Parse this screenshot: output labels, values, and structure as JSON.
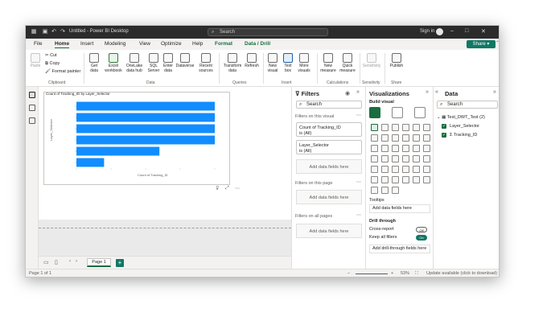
{
  "titlebar": {
    "title": "Untitled - Power BI Desktop",
    "search_placeholder": "Search",
    "signin": "Sign in"
  },
  "menu": {
    "tabs": [
      "File",
      "Home",
      "Insert",
      "Modeling",
      "View",
      "Optimize",
      "Help",
      "Format",
      "Data / Drill"
    ],
    "share": "Share"
  },
  "ribbon": {
    "clipboard": {
      "paste": "Paste",
      "cut": "Cut",
      "copy": "Copy",
      "format_painter": "Format painter",
      "label": "Clipboard"
    },
    "data": {
      "get_data": "Get data",
      "excel": "Excel workbook",
      "onelake": "OneLake data hub",
      "sql": "SQL Server",
      "enter": "Enter data",
      "dataverse": "Dataverse",
      "recent": "Recent sources",
      "label": "Data"
    },
    "queries": {
      "transform": "Transform data",
      "refresh": "Refresh",
      "label": "Queries"
    },
    "insert": {
      "new_visual": "New visual",
      "text_box": "Text box",
      "more_visuals": "More visuals",
      "label": "Insert"
    },
    "calculations": {
      "new_measure": "New measure",
      "quick_measure": "Quick measure",
      "label": "Calculations"
    },
    "sensitivity": {
      "sensitivity": "Sensitivity",
      "label": "Sensitivity"
    },
    "share": {
      "publish": "Publish",
      "label": "Share"
    }
  },
  "visual": {
    "title": "Count of Tracking_ID by Layer_Selector",
    "x_axis_label": "Count of Tracking_ID",
    "y_axis_label": "Layer_Selector"
  },
  "chart_data": {
    "type": "bar",
    "orientation": "horizontal",
    "title": "Count of Tracking_ID by Layer_Selector",
    "xlabel": "Count of Tracking_ID",
    "ylabel": "Layer_Selector",
    "values": [
      10,
      10,
      10,
      10,
      6,
      2
    ],
    "xlim": [
      0,
      10
    ],
    "color": "#118DFF"
  },
  "pagebar": {
    "page_label": "Page 1",
    "add": "+"
  },
  "status": {
    "page_count": "Page 1 of 1",
    "zoom": "53%",
    "update": "Update available (click to download)"
  },
  "filters": {
    "title": "Filters",
    "search": "Search",
    "on_visual": "Filters on this visual",
    "card1_field": "Count of Tracking_ID",
    "card1_value": "is (All)",
    "card2_field": "Layer_Selector",
    "card2_value": "is (All)",
    "add_fields": "Add data fields here",
    "on_page": "Filters on this page",
    "on_all": "Filters on all pages"
  },
  "visualizations": {
    "title": "Visualizations",
    "build": "Build visual",
    "tooltips": "Tooltips",
    "add_fields": "Add data fields here",
    "drill_through": "Drill through",
    "cross_report": "Cross-report",
    "cross_report_state": "Off",
    "keep_all": "Keep all filters",
    "keep_all_state": "On",
    "add_drill": "Add drill-through fields here"
  },
  "data_pane": {
    "title": "Data",
    "search": "Search",
    "table": "Test_DWT_Test (2)",
    "fields": [
      "Layer_Selector",
      "Tracking_ID"
    ]
  }
}
